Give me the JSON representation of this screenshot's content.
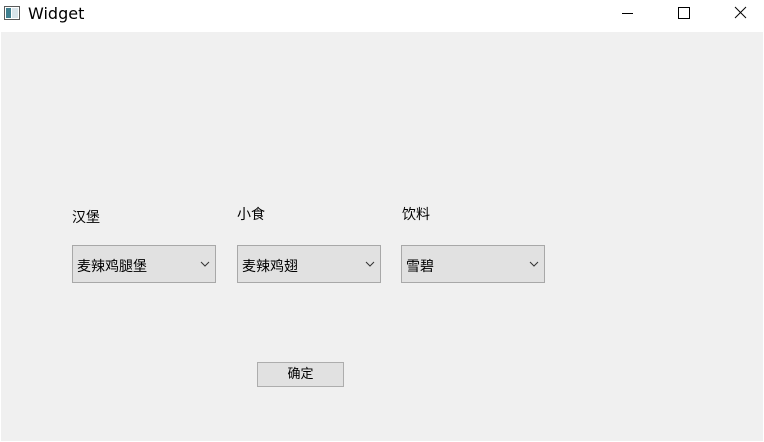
{
  "window": {
    "title": "Widget",
    "icon": "app-window-icon",
    "controls": {
      "minimize_icon": "minimize-icon",
      "maximize_icon": "maximize-icon",
      "close_icon": "close-icon"
    }
  },
  "form": {
    "burger": {
      "label": "汉堡",
      "selected": "麦辣鸡腿堡",
      "icon": "chevron-down-icon"
    },
    "snack": {
      "label": "小食",
      "selected": "麦辣鸡翅",
      "icon": "chevron-down-icon"
    },
    "drink": {
      "label": "饮料",
      "selected": "雪碧",
      "icon": "chevron-down-icon"
    },
    "confirm_label": "确定"
  },
  "colors": {
    "client_background": "#f0f0f0",
    "control_background": "#e1e1e1",
    "control_border": "#a8a8a8"
  }
}
